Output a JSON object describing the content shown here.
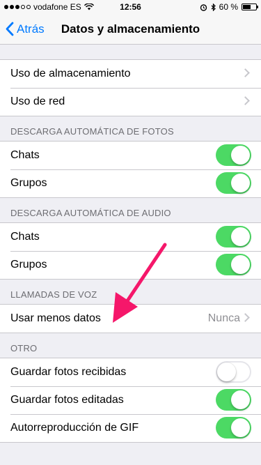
{
  "status_bar": {
    "carrier": "vodafone ES",
    "time": "12:56",
    "battery_text": "60 %"
  },
  "nav": {
    "back_label": "Atrás",
    "title": "Datos y almacenamiento"
  },
  "storage_section": {
    "items": [
      {
        "label": "Uso de almacenamiento"
      },
      {
        "label": "Uso de red"
      }
    ]
  },
  "photos_section": {
    "header": "DESCARGA AUTOMÁTICA DE FOTOS",
    "items": [
      {
        "label": "Chats",
        "enabled": true
      },
      {
        "label": "Grupos",
        "enabled": true
      }
    ]
  },
  "audio_section": {
    "header": "DESCARGA AUTOMÁTICA DE AUDIO",
    "items": [
      {
        "label": "Chats",
        "enabled": true
      },
      {
        "label": "Grupos",
        "enabled": true
      }
    ]
  },
  "voice_section": {
    "header": "LLAMADAS DE VOZ",
    "items": [
      {
        "label": "Usar menos datos",
        "value": "Nunca"
      }
    ]
  },
  "other_section": {
    "header": "OTRO",
    "items": [
      {
        "label": "Guardar fotos recibidas",
        "enabled": false
      },
      {
        "label": "Guardar fotos editadas",
        "enabled": true
      },
      {
        "label": "Autorreproducción de GIF",
        "enabled": true
      }
    ]
  },
  "colors": {
    "accent": "#007aff",
    "toggle_on": "#4cd964",
    "annotation_arrow": "#f5176a"
  }
}
